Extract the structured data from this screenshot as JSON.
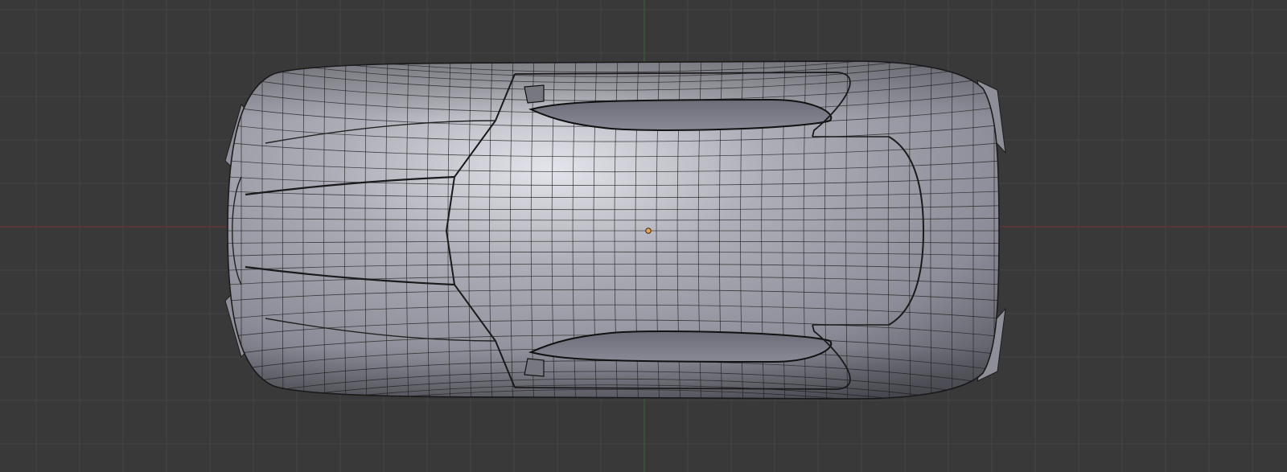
{
  "viewport": {
    "background_color": "#393939",
    "grid_color": "#454545",
    "x_axis_color": "#7a3131",
    "y_axis_color": "#2f6a2f",
    "view": "top",
    "shading": "solid",
    "overlay": "wireframe"
  },
  "object": {
    "type": "car-body-mesh",
    "surface_color": "#9c9ca6",
    "wire_color": "#1c1c1c",
    "origin_color": "#e8a24a"
  }
}
